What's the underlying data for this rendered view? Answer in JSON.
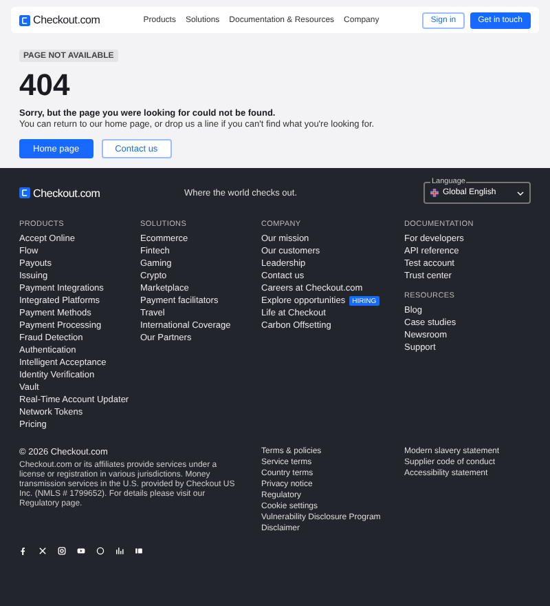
{
  "header": {
    "logo": "Checkout.com",
    "nav": [
      "Products",
      "Solutions",
      "Documentation & Resources",
      "Company"
    ],
    "buttons": [
      {
        "label": "Sign in",
        "kind": "secondary"
      },
      {
        "label": "Get in touch",
        "kind": "primary"
      }
    ]
  },
  "hero": {
    "badge": "PAGE NOT AVAILABLE",
    "code": "404",
    "message_bold": "Sorry, but the page you were looking for could not be found.",
    "message": "You can return to our home page, or drop us a line if you can't find what you're looking for.",
    "buttons": [
      {
        "label": "Home page",
        "kind": "primary"
      },
      {
        "label": "Contact us",
        "kind": "secondary"
      }
    ]
  },
  "footer": {
    "logo": "Checkout.com",
    "tagline": "Where the world checks out.",
    "language": {
      "label": "Language",
      "value": "Global English"
    },
    "columns": [
      {
        "sections": [
          {
            "heading": "PRODUCTS",
            "links": [
              {
                "label": "Accept Online"
              },
              {
                "label": "Flow"
              },
              {
                "label": "Payouts"
              },
              {
                "label": "Issuing"
              },
              {
                "label": "Payment Integrations"
              },
              {
                "label": "Integrated Platforms"
              },
              {
                "label": "Payment Methods"
              },
              {
                "label": "Payment Processing"
              },
              {
                "label": "Fraud Detection"
              },
              {
                "label": "Authentication"
              },
              {
                "label": "Intelligent Acceptance"
              },
              {
                "label": "Identity Verification"
              },
              {
                "label": "Vault"
              },
              {
                "label": "Real-Time Account Updater"
              },
              {
                "label": "Network Tokens"
              },
              {
                "label": "Pricing"
              }
            ]
          }
        ]
      },
      {
        "sections": [
          {
            "heading": "SOLUTIONS",
            "links": [
              {
                "label": "Ecommerce"
              },
              {
                "label": "Fintech"
              },
              {
                "label": "Gaming"
              },
              {
                "label": "Crypto"
              },
              {
                "label": "Marketplace"
              },
              {
                "label": "Payment facilitators"
              },
              {
                "label": "Travel"
              },
              {
                "label": "International Coverage"
              },
              {
                "label": "Our Partners"
              }
            ]
          }
        ]
      },
      {
        "sections": [
          {
            "heading": "COMPANY",
            "links": [
              {
                "label": "Our mission"
              },
              {
                "label": "Our customers"
              },
              {
                "label": "Leadership"
              },
              {
                "label": "Contact us"
              },
              {
                "label": "Careers at Checkout.com"
              },
              {
                "label": "Explore opportunities",
                "badge": "HIRING"
              },
              {
                "label": "Life at Checkout"
              },
              {
                "label": "Carbon Offsetting"
              }
            ]
          }
        ]
      },
      {
        "sections": [
          {
            "heading": "DOCUMENTATION",
            "links": [
              {
                "label": "For developers"
              },
              {
                "label": "API reference"
              },
              {
                "label": "Test account"
              },
              {
                "label": "Trust center"
              }
            ]
          },
          {
            "heading": "RESOURCES",
            "links": [
              {
                "label": "Blog"
              },
              {
                "label": "Case studies"
              },
              {
                "label": "Newsroom"
              },
              {
                "label": "Support"
              }
            ]
          }
        ]
      }
    ],
    "copyright": "© 2026 Checkout.com",
    "legal_text": "Checkout.com or its affiliates provide services under a license or registration in various jurisdictions. Money transmission services in the U.S. provided by Checkout US Inc. (NMLS # 1799652). For details please visit our Regulatory page.",
    "legal_links": [
      [
        "Terms & policies",
        "Service terms",
        "Country terms",
        "Privacy notice",
        "Regulatory",
        "Cookie settings",
        "Vulnerability Disclosure Program",
        "Disclaimer"
      ],
      [
        "Modern slavery statement",
        "Supplier code of conduct",
        "Accessibility statement"
      ]
    ]
  }
}
